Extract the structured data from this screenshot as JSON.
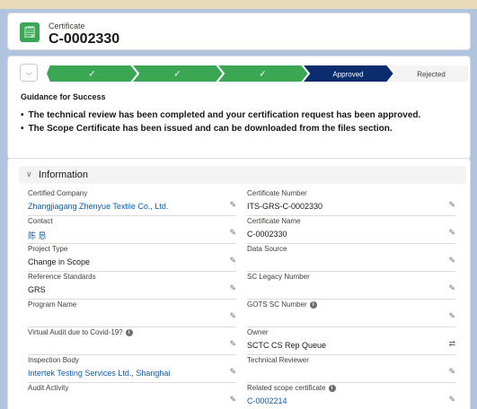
{
  "header": {
    "object_label": "Certificate",
    "record_name": "C-0002330",
    "icon": "certificate-icon"
  },
  "path": {
    "stages": [
      {
        "label": "✓",
        "state": "complete"
      },
      {
        "label": "✓",
        "state": "complete"
      },
      {
        "label": "✓",
        "state": "complete"
      },
      {
        "label": "Approved",
        "state": "current"
      },
      {
        "label": "Rejected",
        "state": "incomplete"
      },
      {
        "label": "",
        "state": "incomplete"
      }
    ]
  },
  "guidance": {
    "title": "Guidance for Success",
    "items": [
      "The technical review has been completed and your certification request has been approved.",
      "The Scope Certificate has been issued and can be downloaded from the files section."
    ]
  },
  "information": {
    "section_title": "Information",
    "left_fields": [
      {
        "label": "Certified Company",
        "value": "Zhangjiagang Zhenyue Textile Co., Ltd.",
        "link": true,
        "info": false
      },
      {
        "label": "Contact",
        "value": "陈 恳",
        "link": true,
        "info": false
      },
      {
        "label": "Project Type",
        "value": "Change in Scope",
        "link": false,
        "info": false
      },
      {
        "label": "Reference Standards",
        "value": "GRS",
        "link": false,
        "info": false
      },
      {
        "label": "Program Name",
        "value": "",
        "link": false,
        "info": false
      },
      {
        "label": "Virtual Audit due to Covid-19?",
        "value": "",
        "link": false,
        "info": true
      },
      {
        "label": "Inspection Body",
        "value": "Intertek Testing Services Ltd., Shanghai",
        "link": true,
        "info": false
      },
      {
        "label": "Audit Activity",
        "value": "",
        "link": false,
        "info": false
      }
    ],
    "right_fields": [
      {
        "label": "Certificate Number",
        "value": "ITS-GRS-C-0002330",
        "link": false,
        "info": false
      },
      {
        "label": "Certificate Name",
        "value": "C-0002330",
        "link": false,
        "info": false
      },
      {
        "label": "Data Source",
        "value": "",
        "link": false,
        "info": false
      },
      {
        "label": "SC Legacy Number",
        "value": "",
        "link": false,
        "info": false
      },
      {
        "label": "GOTS SC Number",
        "value": "",
        "link": false,
        "info": true
      },
      {
        "label": "Owner",
        "value": "SCTC CS Rep Queue",
        "link": false,
        "info": false,
        "owner": true
      },
      {
        "label": "Technical Reviewer",
        "value": "",
        "link": false,
        "info": false
      },
      {
        "label": "Related scope certificate",
        "value": "C-0002214",
        "link": true,
        "info": true
      }
    ]
  },
  "colors": {
    "complete": "#3ba755",
    "current": "#0b2d6e",
    "incomplete": "#f3f3f3",
    "link": "#0b5cab"
  }
}
